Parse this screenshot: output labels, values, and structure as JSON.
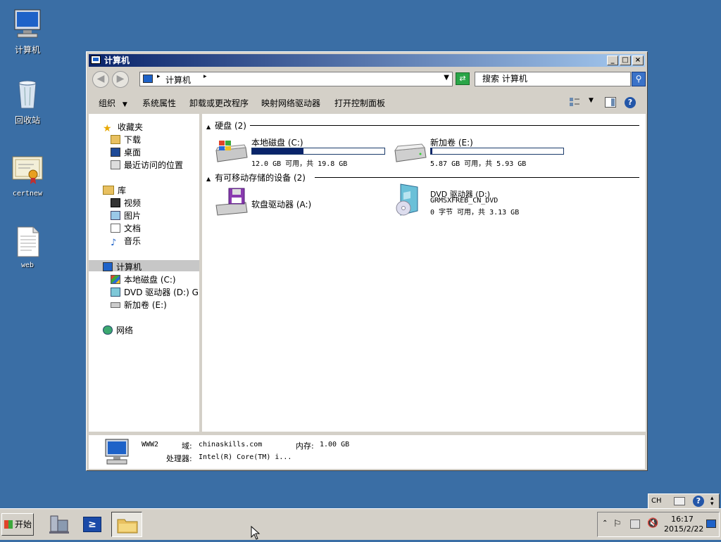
{
  "desktop": {
    "icons": [
      {
        "label": "计算机",
        "icon": "computer-icon"
      },
      {
        "label": "回收站",
        "icon": "recycle-bin-icon"
      },
      {
        "label": "certnew",
        "icon": "certificate-icon"
      },
      {
        "label": "web",
        "icon": "text-file-icon"
      }
    ]
  },
  "window": {
    "title": "计算机",
    "address": {
      "path": "计算机",
      "search_placeholder": "搜索 计算机"
    },
    "toolbar": {
      "organize": "组织",
      "system_properties": "系统属性",
      "uninstall": "卸载或更改程序",
      "map_drive": "映射网络驱动器",
      "control_panel": "打开控制面板"
    },
    "nav": {
      "favorites": "收藏夹",
      "downloads": "下载",
      "desktop": "桌面",
      "recent": "最近访问的位置",
      "libraries": "库",
      "videos": "视频",
      "pictures": "图片",
      "documents": "文档",
      "music": "音乐",
      "computer": "计算机",
      "local_disk": "本地磁盘 (C:)",
      "dvd": "DVD 驱动器 (D:) GF",
      "new_volume": "新加卷 (E:)",
      "network": "网络"
    },
    "content": {
      "hdd_group": "硬盘 (2)",
      "removable_group": "有可移动存储的设备 (2)",
      "drives": [
        {
          "name": "本地磁盘 (C:)",
          "detail": "12.0 GB 可用，共 19.8 GB",
          "used_fraction": 0.39
        },
        {
          "name": "新加卷 (E:)",
          "detail": "5.87 GB 可用，共 5.93 GB",
          "used_fraction": 0.01
        }
      ],
      "floppy": {
        "name": "软盘驱动器 (A:)"
      },
      "dvd": {
        "name": "DVD 驱动器 (D:)",
        "label": "GRMSXFREB_CN_DVD",
        "detail": "0 字节 可用，共 3.13 GB"
      }
    },
    "details": {
      "name": "WWW2",
      "domain_label": "域:",
      "domain": "chinaskills.com",
      "memory_label": "内存:",
      "memory": "1.00 GB",
      "cpu_label": "处理器:",
      "cpu": "Intel(R) Core(TM) i..."
    }
  },
  "taskbar": {
    "start": "开始",
    "language": "CH",
    "time": "16:17",
    "date": "2015/2/22"
  },
  "colors": {
    "desktop": "#3a6ea5",
    "titlebar": "#0a246a",
    "bar_fill": "#0a246a"
  }
}
